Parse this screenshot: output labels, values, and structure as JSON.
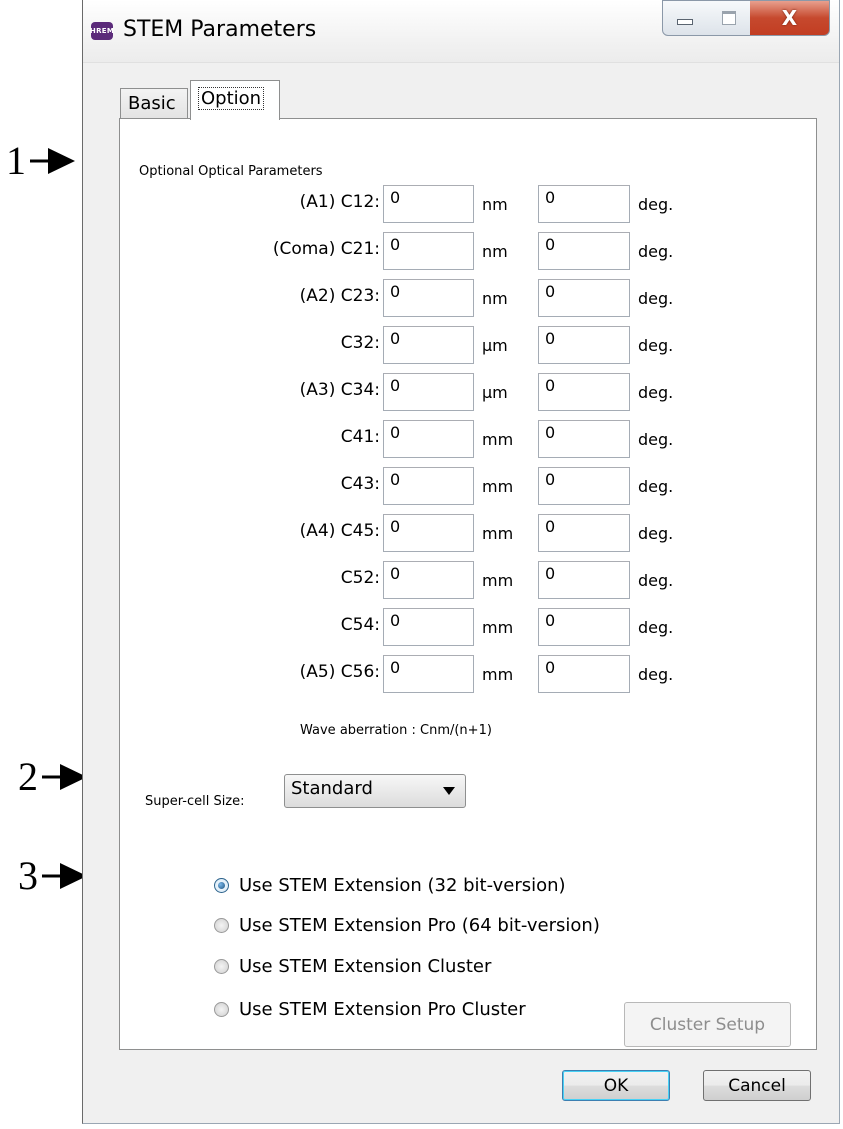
{
  "annotations": [
    "1",
    "2",
    "3"
  ],
  "window": {
    "icon_text": "HREM",
    "title": "STEM Parameters",
    "controls": {
      "minimize": "minimize",
      "maximize": "maximize",
      "close": "X"
    }
  },
  "tabs": [
    "Basic",
    "Option"
  ],
  "active_tab": "Option",
  "option": {
    "section_title": "Optional Optical Parameters",
    "rows": [
      {
        "label": "(A1) C12:",
        "value": "0",
        "unit": "nm",
        "angle": "0",
        "angle_unit": "deg."
      },
      {
        "label": "(Coma) C21:",
        "value": "0",
        "unit": "nm",
        "angle": "0",
        "angle_unit": "deg."
      },
      {
        "label": "(A2) C23:",
        "value": "0",
        "unit": "nm",
        "angle": "0",
        "angle_unit": "deg."
      },
      {
        "label": "C32:",
        "value": "0",
        "unit": "μm",
        "angle": "0",
        "angle_unit": "deg."
      },
      {
        "label": "(A3) C34:",
        "value": "0",
        "unit": "μm",
        "angle": "0",
        "angle_unit": "deg."
      },
      {
        "label": "C41:",
        "value": "0",
        "unit": "mm",
        "angle": "0",
        "angle_unit": "deg."
      },
      {
        "label": "C43:",
        "value": "0",
        "unit": "mm",
        "angle": "0",
        "angle_unit": "deg."
      },
      {
        "label": "(A4) C45:",
        "value": "0",
        "unit": "mm",
        "angle": "0",
        "angle_unit": "deg."
      },
      {
        "label": "C52:",
        "value": "0",
        "unit": "mm",
        "angle": "0",
        "angle_unit": "deg."
      },
      {
        "label": "C54:",
        "value": "0",
        "unit": "mm",
        "angle": "0",
        "angle_unit": "deg."
      },
      {
        "label": "(A5) C56:",
        "value": "0",
        "unit": "mm",
        "angle": "0",
        "angle_unit": "deg."
      }
    ],
    "note": "Wave aberration : Cnm/(n+1)",
    "supercell_label": "Super-cell Size:",
    "supercell_value": "Standard",
    "radio_options": [
      {
        "label": "Use STEM Extension (32 bit-version)",
        "checked": true
      },
      {
        "label": "Use STEM Extension Pro (64 bit-version)",
        "checked": false
      },
      {
        "label": "Use STEM Extension Cluster",
        "checked": false
      },
      {
        "label": "Use STEM Extension Pro Cluster",
        "checked": false
      }
    ],
    "cluster_button": "Cluster Setup"
  },
  "buttons": {
    "ok": "OK",
    "cancel": "Cancel"
  },
  "colors": {
    "close_button": "#c6492e",
    "radio_selected": "#1c5380",
    "ok_focus": "#3c7fb1"
  }
}
